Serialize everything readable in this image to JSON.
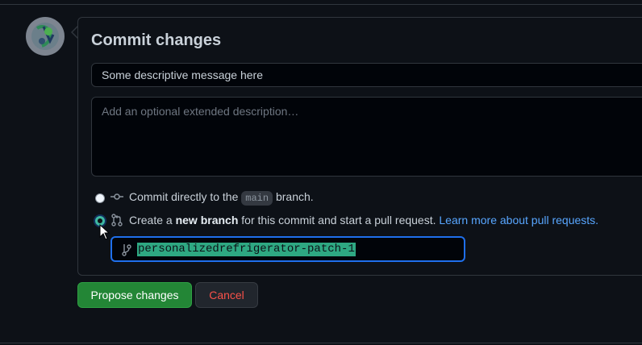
{
  "commit": {
    "title": "Commit changes",
    "summary_value": "Some descriptive message here",
    "description_placeholder": "Add an optional extended description…"
  },
  "options": {
    "direct": {
      "prefix": "Commit directly to the",
      "branch": "main",
      "suffix": "branch."
    },
    "new_branch": {
      "prefix": "Create a",
      "bold": "new branch",
      "suffix": "for this commit and start a pull request.",
      "link": "Learn more about pull requests."
    },
    "selected": "new_branch"
  },
  "branch_input": {
    "value": "personalizedrefrigerator-patch-1"
  },
  "actions": {
    "propose_label": "Propose changes",
    "cancel_label": "Cancel"
  },
  "colors": {
    "primary_button": "#238636",
    "cancel_text": "#f85149",
    "link": "#58a6ff",
    "focus_ring": "#1f6feb",
    "selection": "#2ea882"
  },
  "icons": {
    "avatar": "user-avatar",
    "commit": "git-commit-icon",
    "pull_request": "git-pull-request-icon",
    "branch": "git-branch-icon",
    "cursor": "mouse-pointer-icon"
  }
}
